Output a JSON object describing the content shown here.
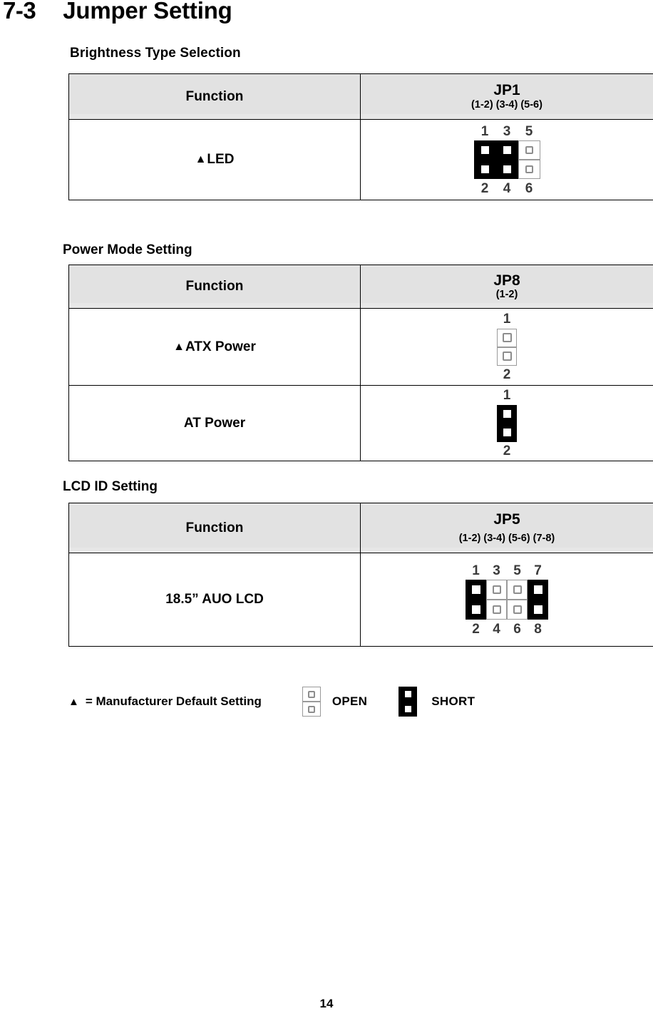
{
  "document": {
    "section_number": "7-3",
    "section_title": "Jumper Setting",
    "page_number": "14"
  },
  "sections": [
    {
      "heading": "Brightness Type Selection",
      "columns": {
        "function": "Function",
        "jumper_name": "JP1",
        "jumper_pins": "(1-2) (3-4) (5-6)"
      },
      "rows": [
        {
          "function": "LED",
          "is_default": true,
          "default_marker": "▲",
          "jumper": {
            "top_labels": [
              "1",
              "3",
              "5"
            ],
            "bottom_labels": [
              "2",
              "4",
              "6"
            ],
            "columns": [
              "short",
              "short",
              "open"
            ]
          }
        }
      ]
    },
    {
      "heading": "Power Mode Setting",
      "columns": {
        "function": "Function",
        "jumper_name": "JP8",
        "jumper_pins": "(1-2)"
      },
      "rows": [
        {
          "function": "ATX Power",
          "is_default": true,
          "default_marker": "▲",
          "jumper": {
            "top_labels": [
              "1"
            ],
            "bottom_labels": [
              "2"
            ],
            "columns": [
              "open"
            ]
          }
        },
        {
          "function": "AT Power",
          "is_default": false,
          "default_marker": "",
          "jumper": {
            "top_labels": [
              "1"
            ],
            "bottom_labels": [
              "2"
            ],
            "columns": [
              "short"
            ]
          }
        }
      ]
    },
    {
      "heading": "LCD ID Setting",
      "columns": {
        "function": "Function",
        "jumper_name": "JP5",
        "jumper_pins": "(1-2) (3-4) (5-6) (7-8)"
      },
      "rows": [
        {
          "function": "18.5” AUO LCD",
          "is_default": false,
          "default_marker": "",
          "jumper": {
            "top_labels": [
              "1",
              "3",
              "5",
              "7"
            ],
            "bottom_labels": [
              "2",
              "4",
              "6",
              "8"
            ],
            "columns": [
              "short",
              "open",
              "open",
              "short"
            ]
          }
        }
      ]
    }
  ],
  "legend": {
    "marker": "▲",
    "text": "= Manufacturer Default Setting",
    "open_label": "OPEN",
    "short_label": "SHORT"
  }
}
